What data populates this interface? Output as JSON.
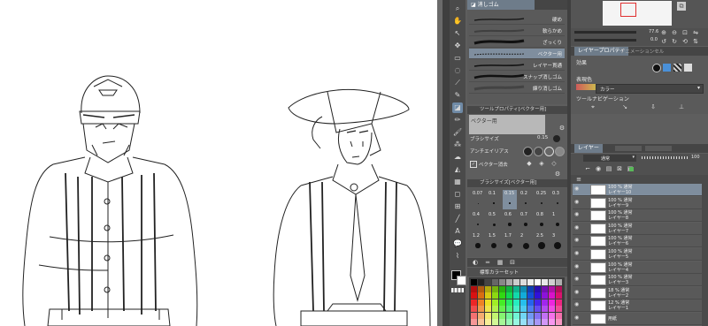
{
  "subtool": {
    "tab_label": "消しゴム",
    "brushes": [
      {
        "label": "硬め"
      },
      {
        "label": "軟らかめ"
      },
      {
        "label": "ざっくり"
      },
      {
        "label": "ベクター用"
      },
      {
        "label": "レイヤー貫通"
      },
      {
        "label": "スナップ消しゴム"
      },
      {
        "label": "練り消しゴム"
      }
    ]
  },
  "tool_property": {
    "header": "ツールプロパティ[ベクター用]",
    "preset_name": "ベクター用",
    "brush_size_label": "ブラシサイズ",
    "brush_size_value": "0.15",
    "antialias_label": "アンチエイリアス",
    "vector_label": "ベクター消去"
  },
  "brush_size_palette": {
    "header": "ブラシサイズ[ベクター用]",
    "sizes": [
      "0.07",
      "0.1",
      "0.15",
      "0.2",
      "0.25",
      "0.3",
      "0.4",
      "0.5",
      "0.6",
      "0.7",
      "0.8",
      "1",
      "1.2",
      "1.5",
      "1.7",
      "2",
      "2.5",
      "3"
    ]
  },
  "color_set": {
    "header": "標準カラーセット"
  },
  "navigator": {
    "zoom": "77.6",
    "angle": "0.0"
  },
  "layer_property": {
    "tab1": "レイヤープロパティ",
    "tab2": "アニメーションセル",
    "effect_label": "効果",
    "expression_label": "表現色",
    "expression_value": "カラー",
    "tool_nav_label": "ツールナビゲーション"
  },
  "layer_panel": {
    "tab": "レイヤー",
    "blend_mode": "通常",
    "opacity": "100",
    "layers": [
      {
        "mode": "100 % 通常",
        "name": "レイヤー10"
      },
      {
        "mode": "100 % 通常",
        "name": "レイヤー9"
      },
      {
        "mode": "100 % 通常",
        "name": "レイヤー8"
      },
      {
        "mode": "100 % 通常",
        "name": "レイヤー7"
      },
      {
        "mode": "100 % 通常",
        "name": "レイヤー6"
      },
      {
        "mode": "100 % 通常",
        "name": "レイヤー5"
      },
      {
        "mode": "100 % 通常",
        "name": "レイヤー4"
      },
      {
        "mode": "100 % 通常",
        "name": "レイヤー3"
      },
      {
        "mode": "18 % 通常",
        "name": "レイヤー2"
      },
      {
        "mode": "12 % 通常",
        "name": "レイヤー1"
      },
      {
        "mode": "",
        "name": "用紙"
      }
    ]
  },
  "colors": {
    "main": "#000000",
    "sub": "#ffffff",
    "accent": "#7f8e9e"
  }
}
